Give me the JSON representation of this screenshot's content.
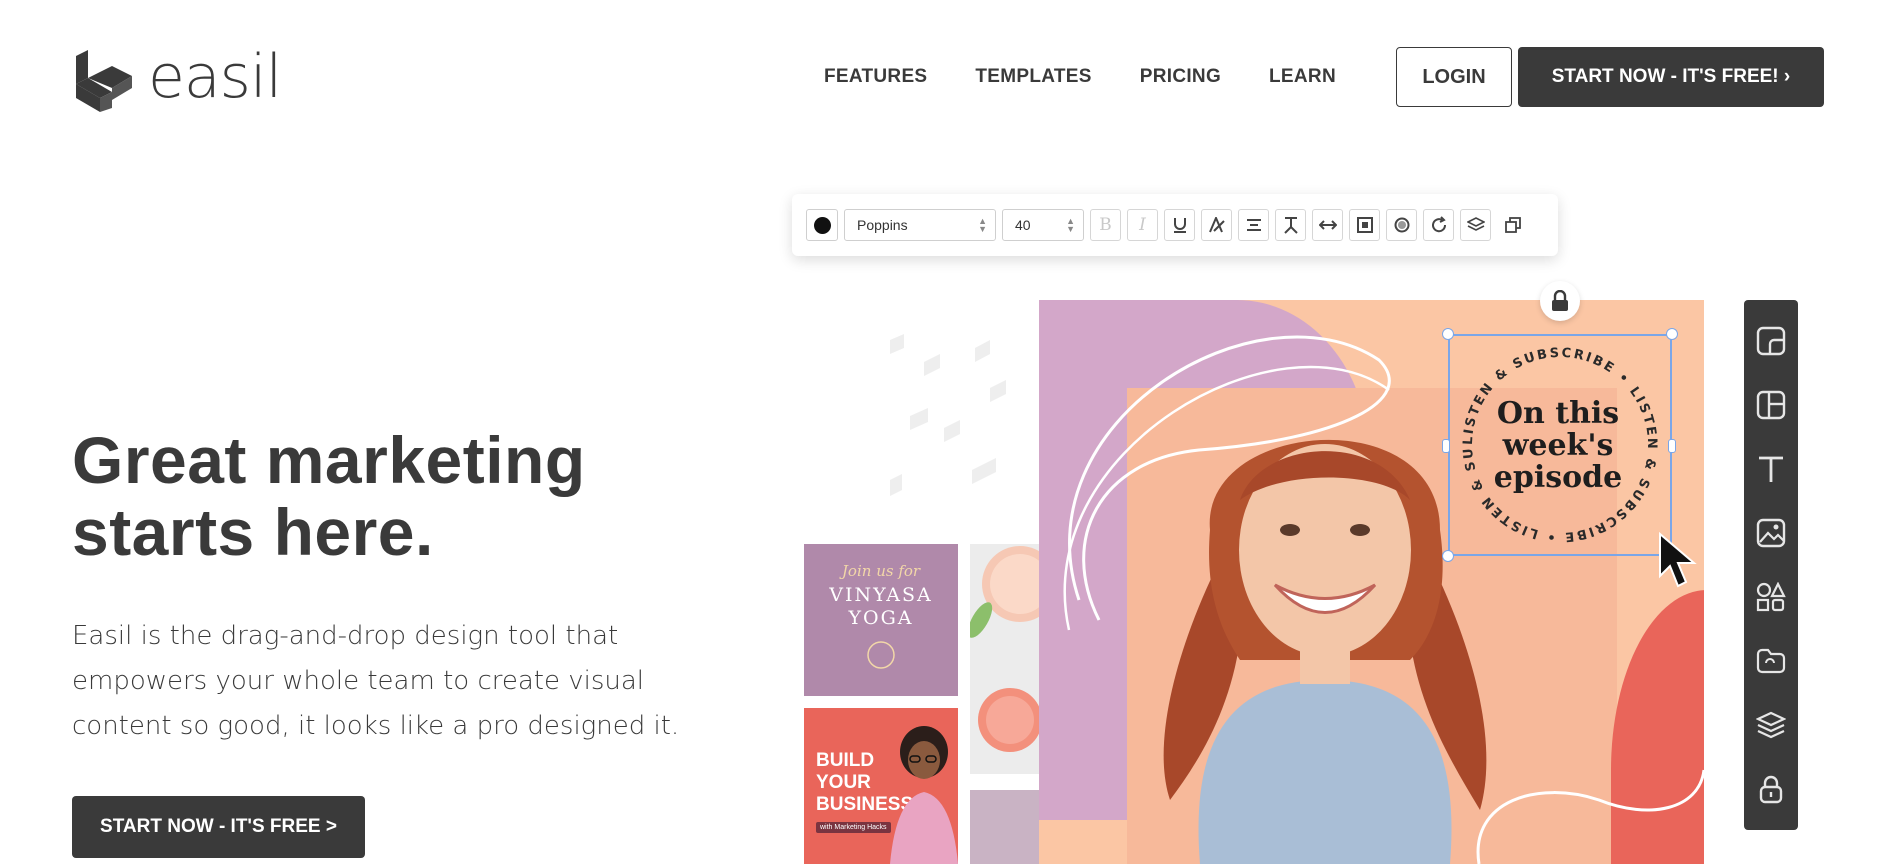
{
  "brand": {
    "name": "easil",
    "accent": "#3a3a3a"
  },
  "nav": {
    "items": [
      {
        "label": "FEATURES"
      },
      {
        "label": "TEMPLATES"
      },
      {
        "label": "PRICING"
      },
      {
        "label": "LEARN"
      }
    ],
    "login_label": "LOGIN",
    "cta_label": "START NOW - IT'S FREE! ›"
  },
  "hero": {
    "title_line1": "Great marketing",
    "title_line2": "starts here.",
    "subtitle_line1": "Easil is the drag-and-drop design tool that",
    "subtitle_line2": "empowers your whole team to create visual",
    "subtitle_line3": "content so good, it looks like a pro designed it.",
    "cta_label": "START NOW - IT'S FREE >"
  },
  "editor": {
    "toolbar": {
      "font_value": "Poppins",
      "size_value": "40",
      "text_color": "#111111",
      "buttons": [
        "bold-icon",
        "italic-icon",
        "underline-icon",
        "text-effect-icon",
        "align-icon",
        "line-height-icon",
        "letter-spacing-icon",
        "opacity-icon",
        "shadow-icon",
        "rotate-icon",
        "layers-icon",
        "duplicate-icon"
      ],
      "bold_glyph": "B",
      "italic_glyph": "I"
    },
    "badge": {
      "ring_text": "LISTEN & SUBSCRIBE • LISTEN & SUBSCRIBE • LISTEN & SUBSCRIBE •",
      "line1": "On this",
      "line2": "week's",
      "line3": "episode"
    },
    "side_rail": [
      "resize-icon",
      "layouts-icon",
      "text-icon",
      "image-icon",
      "shapes-icon",
      "folder-icon",
      "layers-icon",
      "lock-icon"
    ],
    "colors": {
      "canvas_peach": "#fbc6a4",
      "purple": "#d3a7c9",
      "coral": "#e9655a",
      "selection": "#7aa6e8"
    }
  },
  "thumbnails": {
    "yoga_script": "Join us for",
    "yoga_title_1": "VINYASA",
    "yoga_title_2": "YOGA",
    "business_line1": "BUILD",
    "business_line2": "YOUR",
    "business_line3": "BUSINESS",
    "business_sub": "with Marketing Hacks"
  }
}
